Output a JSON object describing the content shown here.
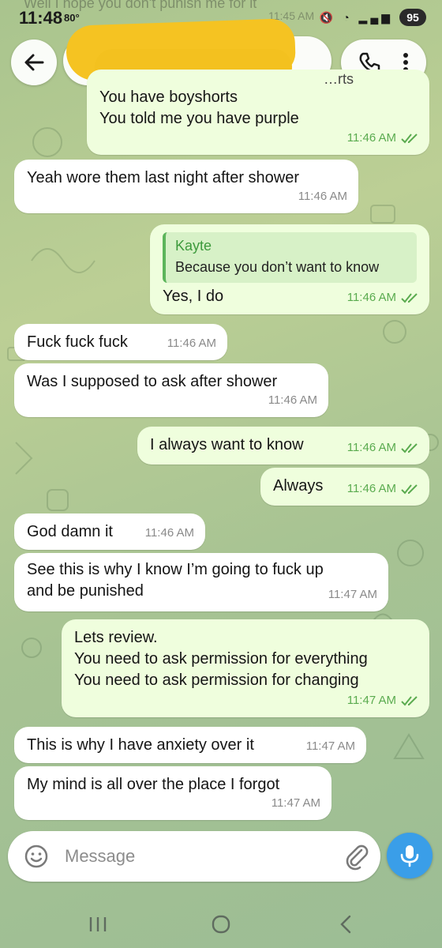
{
  "status_bar": {
    "time": "11:48",
    "temp": "80°",
    "battery": "95",
    "ghost_text": "Well I hope you don't punish me for it",
    "ghost_time": "11:45 AM"
  },
  "header": {
    "back_icon": "arrow-left-icon",
    "call_icon": "phone-icon",
    "menu_icon": "more-vertical-icon"
  },
  "messages": [
    {
      "dir": "out",
      "partial_text": "…rts",
      "text": "You have boyshorts\nYou told me you have purple",
      "time": "11:46 AM",
      "read": true
    },
    {
      "dir": "in",
      "text": "Yeah wore them last night after shower",
      "time": "11:46 AM"
    },
    {
      "dir": "out",
      "reply_name": "Kayte",
      "reply_text": "Because you don’t want to know",
      "text": "Yes, I do",
      "time": "11:46 AM",
      "read": true
    },
    {
      "dir": "in",
      "text": "Fuck fuck fuck",
      "time": "11:46 AM"
    },
    {
      "dir": "in",
      "text": "Was I supposed to ask after shower",
      "time": "11:46 AM"
    },
    {
      "dir": "out",
      "text": "I always want to know",
      "time": "11:46 AM",
      "read": true
    },
    {
      "dir": "out",
      "text": "Always",
      "time": "11:46 AM",
      "read": true
    },
    {
      "dir": "in",
      "text": "God damn it",
      "time": "11:46 AM"
    },
    {
      "dir": "in",
      "text": "See this is why I know I’m going to fuck up\nand be punished",
      "time": "11:47 AM"
    },
    {
      "dir": "out",
      "text": "Lets review.\nYou need to ask permission for everything\nYou need to ask permission for changing",
      "time": "11:47 AM",
      "read": true
    },
    {
      "dir": "in",
      "text": "This is why I have anxiety over it",
      "time": "11:47 AM"
    },
    {
      "dir": "in",
      "text": "My mind is all over the place I forgot",
      "time": "11:47 AM"
    }
  ],
  "composer": {
    "placeholder": "Message",
    "emoji_icon": "emoji-icon",
    "attach_icon": "paperclip-icon",
    "mic_icon": "microphone-icon"
  },
  "nav": {
    "recents_icon": "recents-icon",
    "home_icon": "home-icon",
    "back_icon": "back-icon"
  },
  "colors": {
    "outgoing_bubble": "#effedd",
    "incoming_bubble": "#ffffff",
    "tick_green": "#5aab4f",
    "accent_blue": "#3a9ee8",
    "redaction": "#f5c322"
  }
}
